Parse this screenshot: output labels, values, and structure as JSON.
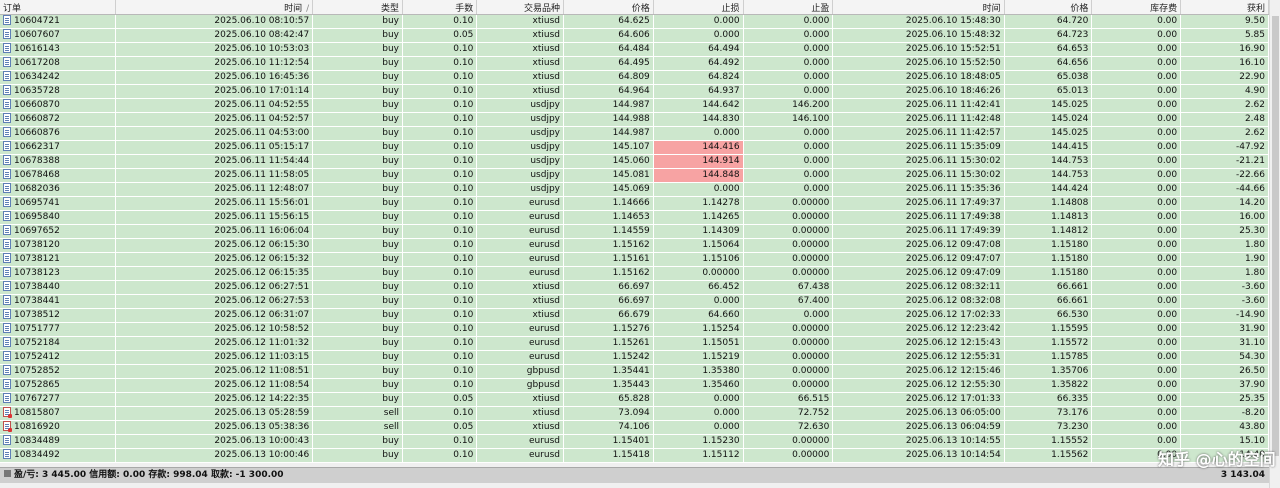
{
  "headers": {
    "order": "订单",
    "open_time": "时间",
    "sort_indicator": "/",
    "type": "类型",
    "volume": "手数",
    "symbol": "交易品种",
    "open_price": "价格",
    "sl": "止损",
    "tp": "止盈",
    "close_time": "时间",
    "close_price": "价格",
    "swap": "库存费",
    "profit": "获利"
  },
  "rows": [
    {
      "order": "10604721",
      "open_time": "2025.06.10 08:10:57",
      "type": "buy",
      "volume": "0.10",
      "symbol": "xtiusd",
      "open_price": "64.625",
      "sl": "0.000",
      "tp": "0.000",
      "close_time": "2025.06.10 15:48:30",
      "close_price": "64.720",
      "swap": "0.00",
      "profit": "9.50",
      "sl_hit": false
    },
    {
      "order": "10607607",
      "open_time": "2025.06.10 08:42:47",
      "type": "buy",
      "volume": "0.05",
      "symbol": "xtiusd",
      "open_price": "64.606",
      "sl": "0.000",
      "tp": "0.000",
      "close_time": "2025.06.10 15:48:32",
      "close_price": "64.723",
      "swap": "0.00",
      "profit": "5.85",
      "sl_hit": false
    },
    {
      "order": "10616143",
      "open_time": "2025.06.10 10:53:03",
      "type": "buy",
      "volume": "0.10",
      "symbol": "xtiusd",
      "open_price": "64.484",
      "sl": "64.494",
      "tp": "0.000",
      "close_time": "2025.06.10 15:52:51",
      "close_price": "64.653",
      "swap": "0.00",
      "profit": "16.90",
      "sl_hit": false
    },
    {
      "order": "10617208",
      "open_time": "2025.06.10 11:12:54",
      "type": "buy",
      "volume": "0.10",
      "symbol": "xtiusd",
      "open_price": "64.495",
      "sl": "64.492",
      "tp": "0.000",
      "close_time": "2025.06.10 15:52:50",
      "close_price": "64.656",
      "swap": "0.00",
      "profit": "16.10",
      "sl_hit": false
    },
    {
      "order": "10634242",
      "open_time": "2025.06.10 16:45:36",
      "type": "buy",
      "volume": "0.10",
      "symbol": "xtiusd",
      "open_price": "64.809",
      "sl": "64.824",
      "tp": "0.000",
      "close_time": "2025.06.10 18:48:05",
      "close_price": "65.038",
      "swap": "0.00",
      "profit": "22.90",
      "sl_hit": false
    },
    {
      "order": "10635728",
      "open_time": "2025.06.10 17:01:14",
      "type": "buy",
      "volume": "0.10",
      "symbol": "xtiusd",
      "open_price": "64.964",
      "sl": "64.937",
      "tp": "0.000",
      "close_time": "2025.06.10 18:46:26",
      "close_price": "65.013",
      "swap": "0.00",
      "profit": "4.90",
      "sl_hit": false
    },
    {
      "order": "10660870",
      "open_time": "2025.06.11 04:52:55",
      "type": "buy",
      "volume": "0.10",
      "symbol": "usdjpy",
      "open_price": "144.987",
      "sl": "144.642",
      "tp": "146.200",
      "close_time": "2025.06.11 11:42:41",
      "close_price": "145.025",
      "swap": "0.00",
      "profit": "2.62",
      "sl_hit": false
    },
    {
      "order": "10660872",
      "open_time": "2025.06.11 04:52:57",
      "type": "buy",
      "volume": "0.10",
      "symbol": "usdjpy",
      "open_price": "144.988",
      "sl": "144.830",
      "tp": "146.100",
      "close_time": "2025.06.11 11:42:48",
      "close_price": "145.024",
      "swap": "0.00",
      "profit": "2.48",
      "sl_hit": false
    },
    {
      "order": "10660876",
      "open_time": "2025.06.11 04:53:00",
      "type": "buy",
      "volume": "0.10",
      "symbol": "usdjpy",
      "open_price": "144.987",
      "sl": "0.000",
      "tp": "0.000",
      "close_time": "2025.06.11 11:42:57",
      "close_price": "145.025",
      "swap": "0.00",
      "profit": "2.62",
      "sl_hit": false
    },
    {
      "order": "10662317",
      "open_time": "2025.06.11 05:15:17",
      "type": "buy",
      "volume": "0.10",
      "symbol": "usdjpy",
      "open_price": "145.107",
      "sl": "144.416",
      "tp": "0.000",
      "close_time": "2025.06.11 15:35:09",
      "close_price": "144.415",
      "swap": "0.00",
      "profit": "-47.92",
      "sl_hit": true
    },
    {
      "order": "10678388",
      "open_time": "2025.06.11 11:54:44",
      "type": "buy",
      "volume": "0.10",
      "symbol": "usdjpy",
      "open_price": "145.060",
      "sl": "144.914",
      "tp": "0.000",
      "close_time": "2025.06.11 15:30:02",
      "close_price": "144.753",
      "swap": "0.00",
      "profit": "-21.21",
      "sl_hit": true
    },
    {
      "order": "10678468",
      "open_time": "2025.06.11 11:58:05",
      "type": "buy",
      "volume": "0.10",
      "symbol": "usdjpy",
      "open_price": "145.081",
      "sl": "144.848",
      "tp": "0.000",
      "close_time": "2025.06.11 15:30:02",
      "close_price": "144.753",
      "swap": "0.00",
      "profit": "-22.66",
      "sl_hit": true
    },
    {
      "order": "10682036",
      "open_time": "2025.06.11 12:48:07",
      "type": "buy",
      "volume": "0.10",
      "symbol": "usdjpy",
      "open_price": "145.069",
      "sl": "0.000",
      "tp": "0.000",
      "close_time": "2025.06.11 15:35:36",
      "close_price": "144.424",
      "swap": "0.00",
      "profit": "-44.66",
      "sl_hit": false
    },
    {
      "order": "10695741",
      "open_time": "2025.06.11 15:56:01",
      "type": "buy",
      "volume": "0.10",
      "symbol": "eurusd",
      "open_price": "1.14666",
      "sl": "1.14278",
      "tp": "0.00000",
      "close_time": "2025.06.11 17:49:37",
      "close_price": "1.14808",
      "swap": "0.00",
      "profit": "14.20",
      "sl_hit": false
    },
    {
      "order": "10695840",
      "open_time": "2025.06.11 15:56:15",
      "type": "buy",
      "volume": "0.10",
      "symbol": "eurusd",
      "open_price": "1.14653",
      "sl": "1.14265",
      "tp": "0.00000",
      "close_time": "2025.06.11 17:49:38",
      "close_price": "1.14813",
      "swap": "0.00",
      "profit": "16.00",
      "sl_hit": false
    },
    {
      "order": "10697652",
      "open_time": "2025.06.11 16:06:04",
      "type": "buy",
      "volume": "0.10",
      "symbol": "eurusd",
      "open_price": "1.14559",
      "sl": "1.14309",
      "tp": "0.00000",
      "close_time": "2025.06.11 17:49:39",
      "close_price": "1.14812",
      "swap": "0.00",
      "profit": "25.30",
      "sl_hit": false
    },
    {
      "order": "10738120",
      "open_time": "2025.06.12 06:15:30",
      "type": "buy",
      "volume": "0.10",
      "symbol": "eurusd",
      "open_price": "1.15162",
      "sl": "1.15064",
      "tp": "0.00000",
      "close_time": "2025.06.12 09:47:08",
      "close_price": "1.15180",
      "swap": "0.00",
      "profit": "1.80",
      "sl_hit": false
    },
    {
      "order": "10738121",
      "open_time": "2025.06.12 06:15:32",
      "type": "buy",
      "volume": "0.10",
      "symbol": "eurusd",
      "open_price": "1.15161",
      "sl": "1.15106",
      "tp": "0.00000",
      "close_time": "2025.06.12 09:47:07",
      "close_price": "1.15180",
      "swap": "0.00",
      "profit": "1.90",
      "sl_hit": false
    },
    {
      "order": "10738123",
      "open_time": "2025.06.12 06:15:35",
      "type": "buy",
      "volume": "0.10",
      "symbol": "eurusd",
      "open_price": "1.15162",
      "sl": "0.00000",
      "tp": "0.00000",
      "close_time": "2025.06.12 09:47:09",
      "close_price": "1.15180",
      "swap": "0.00",
      "profit": "1.80",
      "sl_hit": false
    },
    {
      "order": "10738440",
      "open_time": "2025.06.12 06:27:51",
      "type": "buy",
      "volume": "0.10",
      "symbol": "xtiusd",
      "open_price": "66.697",
      "sl": "66.452",
      "tp": "67.438",
      "close_time": "2025.06.12 08:32:11",
      "close_price": "66.661",
      "swap": "0.00",
      "profit": "-3.60",
      "sl_hit": false
    },
    {
      "order": "10738441",
      "open_time": "2025.06.12 06:27:53",
      "type": "buy",
      "volume": "0.10",
      "symbol": "xtiusd",
      "open_price": "66.697",
      "sl": "0.000",
      "tp": "67.400",
      "close_time": "2025.06.12 08:32:08",
      "close_price": "66.661",
      "swap": "0.00",
      "profit": "-3.60",
      "sl_hit": false
    },
    {
      "order": "10738512",
      "open_time": "2025.06.12 06:31:07",
      "type": "buy",
      "volume": "0.10",
      "symbol": "xtiusd",
      "open_price": "66.679",
      "sl": "64.660",
      "tp": "0.000",
      "close_time": "2025.06.12 17:02:33",
      "close_price": "66.530",
      "swap": "0.00",
      "profit": "-14.90",
      "sl_hit": false
    },
    {
      "order": "10751777",
      "open_time": "2025.06.12 10:58:52",
      "type": "buy",
      "volume": "0.10",
      "symbol": "eurusd",
      "open_price": "1.15276",
      "sl": "1.15254",
      "tp": "0.00000",
      "close_time": "2025.06.12 12:23:42",
      "close_price": "1.15595",
      "swap": "0.00",
      "profit": "31.90",
      "sl_hit": false
    },
    {
      "order": "10752184",
      "open_time": "2025.06.12 11:01:32",
      "type": "buy",
      "volume": "0.10",
      "symbol": "eurusd",
      "open_price": "1.15261",
      "sl": "1.15051",
      "tp": "0.00000",
      "close_time": "2025.06.12 12:15:43",
      "close_price": "1.15572",
      "swap": "0.00",
      "profit": "31.10",
      "sl_hit": false
    },
    {
      "order": "10752412",
      "open_time": "2025.06.12 11:03:15",
      "type": "buy",
      "volume": "0.10",
      "symbol": "eurusd",
      "open_price": "1.15242",
      "sl": "1.15219",
      "tp": "0.00000",
      "close_time": "2025.06.12 12:55:31",
      "close_price": "1.15785",
      "swap": "0.00",
      "profit": "54.30",
      "sl_hit": false
    },
    {
      "order": "10752852",
      "open_time": "2025.06.12 11:08:51",
      "type": "buy",
      "volume": "0.10",
      "symbol": "gbpusd",
      "open_price": "1.35441",
      "sl": "1.35380",
      "tp": "0.00000",
      "close_time": "2025.06.12 12:15:46",
      "close_price": "1.35706",
      "swap": "0.00",
      "profit": "26.50",
      "sl_hit": false
    },
    {
      "order": "10752865",
      "open_time": "2025.06.12 11:08:54",
      "type": "buy",
      "volume": "0.10",
      "symbol": "gbpusd",
      "open_price": "1.35443",
      "sl": "1.35460",
      "tp": "0.00000",
      "close_time": "2025.06.12 12:55:30",
      "close_price": "1.35822",
      "swap": "0.00",
      "profit": "37.90",
      "sl_hit": false
    },
    {
      "order": "10767277",
      "open_time": "2025.06.12 14:22:35",
      "type": "buy",
      "volume": "0.05",
      "symbol": "xtiusd",
      "open_price": "65.828",
      "sl": "0.000",
      "tp": "66.515",
      "close_time": "2025.06.12 17:01:33",
      "close_price": "66.335",
      "swap": "0.00",
      "profit": "25.35",
      "sl_hit": false
    },
    {
      "order": "10815807",
      "open_time": "2025.06.13 05:28:59",
      "type": "sell",
      "volume": "0.10",
      "symbol": "xtiusd",
      "open_price": "73.094",
      "sl": "0.000",
      "tp": "72.752",
      "close_time": "2025.06.13 06:05:00",
      "close_price": "73.176",
      "swap": "0.00",
      "profit": "-8.20",
      "sl_hit": false
    },
    {
      "order": "10816920",
      "open_time": "2025.06.13 05:38:36",
      "type": "sell",
      "volume": "0.05",
      "symbol": "xtiusd",
      "open_price": "74.106",
      "sl": "0.000",
      "tp": "72.630",
      "close_time": "2025.06.13 06:04:59",
      "close_price": "73.230",
      "swap": "0.00",
      "profit": "43.80",
      "sl_hit": false
    },
    {
      "order": "10834489",
      "open_time": "2025.06.13 10:00:43",
      "type": "buy",
      "volume": "0.10",
      "symbol": "eurusd",
      "open_price": "1.15401",
      "sl": "1.15230",
      "tp": "0.00000",
      "close_time": "2025.06.13 10:14:55",
      "close_price": "1.15552",
      "swap": "0.00",
      "profit": "15.10",
      "sl_hit": false
    },
    {
      "order": "10834492",
      "open_time": "2025.06.13 10:00:46",
      "type": "buy",
      "volume": "0.10",
      "symbol": "eurusd",
      "open_price": "1.15418",
      "sl": "1.15112",
      "tp": "0.00000",
      "close_time": "2025.06.13 10:14:54",
      "close_price": "1.15562",
      "swap": "0.00",
      "profit": "14.40",
      "sl_hit": false
    }
  ],
  "footer": {
    "summary": "盈/亏: 3 445.00  信用额: 0.00  存款: 998.04  取款: -1 300.00",
    "total_profit": "3 143.04"
  },
  "watermark": "知乎 @心的空间",
  "colors": {
    "row_bg": "#cde7cd",
    "sl_hit_bg": "#f7a3a3"
  }
}
